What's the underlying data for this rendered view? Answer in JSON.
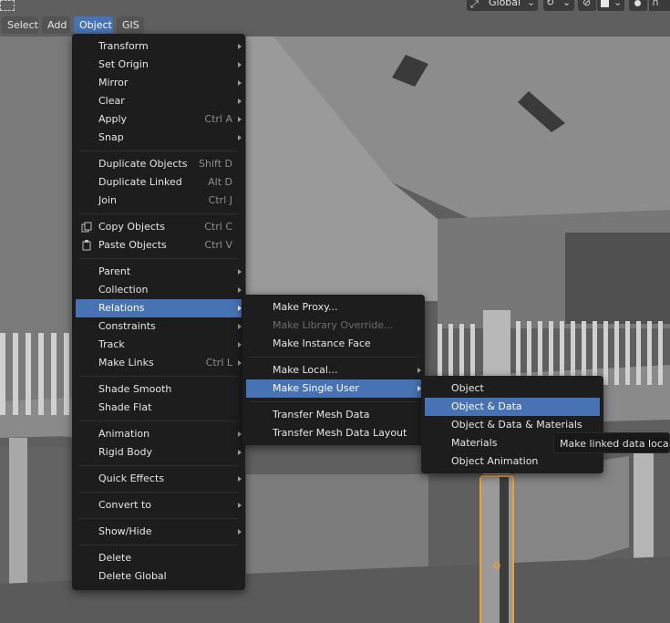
{
  "header": {
    "buttons": [
      "Select",
      "Add",
      "Object",
      "GIS"
    ],
    "orientation": "Global"
  },
  "object_menu": {
    "items": [
      {
        "label": "Transform",
        "submenu": true
      },
      {
        "label": "Set Origin",
        "submenu": true
      },
      {
        "label": "Mirror",
        "submenu": true
      },
      {
        "label": "Clear",
        "submenu": true
      },
      {
        "label": "Apply",
        "shortcut": "Ctrl A",
        "submenu": true
      },
      {
        "label": "Snap",
        "submenu": true
      },
      {
        "label": "Duplicate Objects",
        "shortcut": "Shift D"
      },
      {
        "label": "Duplicate Linked",
        "shortcut": "Alt D"
      },
      {
        "label": "Join",
        "shortcut": "Ctrl J"
      },
      {
        "label": "Copy Objects",
        "shortcut": "Ctrl C",
        "icon": "copy-icon"
      },
      {
        "label": "Paste Objects",
        "shortcut": "Ctrl V",
        "icon": "paste-icon"
      },
      {
        "label": "Parent",
        "submenu": true
      },
      {
        "label": "Collection",
        "submenu": true
      },
      {
        "label": "Relations",
        "submenu": true,
        "highlighted": true
      },
      {
        "label": "Constraints",
        "submenu": true
      },
      {
        "label": "Track",
        "submenu": true
      },
      {
        "label": "Make Links",
        "shortcut": "Ctrl L",
        "submenu": true
      },
      {
        "label": "Shade Smooth"
      },
      {
        "label": "Shade Flat"
      },
      {
        "label": "Animation",
        "submenu": true
      },
      {
        "label": "Rigid Body",
        "submenu": true
      },
      {
        "label": "Quick Effects",
        "submenu": true
      },
      {
        "label": "Convert to",
        "submenu": true
      },
      {
        "label": "Show/Hide",
        "submenu": true
      },
      {
        "label": "Delete"
      },
      {
        "label": "Delete Global"
      }
    ]
  },
  "relations_menu": {
    "items": [
      {
        "label": "Make Proxy..."
      },
      {
        "label": "Make Library Override...",
        "disabled": true
      },
      {
        "label": "Make Instance Face"
      },
      {
        "label": "Make Local...",
        "submenu": true
      },
      {
        "label": "Make Single User",
        "submenu": true,
        "highlighted": true
      },
      {
        "label": "Transfer Mesh Data"
      },
      {
        "label": "Transfer Mesh Data Layout"
      }
    ]
  },
  "single_user_menu": {
    "items": [
      {
        "label": "Object"
      },
      {
        "label": "Object & Data",
        "highlighted": true
      },
      {
        "label": "Object & Data & Materials"
      },
      {
        "label": "Materials"
      },
      {
        "label": "Object Animation"
      }
    ]
  },
  "tooltip": "Make linked data local",
  "colors": {
    "highlight": "#4772b3",
    "menu_bg": "#1d1d1d",
    "selection_outline": "#f0a030"
  }
}
